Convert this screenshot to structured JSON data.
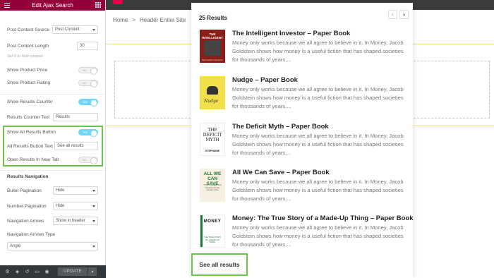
{
  "panel": {
    "title": "Edit Ajax Search",
    "post_content_source": {
      "label": "Post Content Source",
      "value": "Post Content"
    },
    "post_content_length": {
      "label": "Post Content Length",
      "value": "30"
    },
    "hint": "Set 0 to hide content",
    "show_product_price": {
      "label": "Show Product Price",
      "state": "NO"
    },
    "show_product_rating": {
      "label": "Show Product Rating",
      "state": "NO"
    },
    "show_results_counter": {
      "label": "Show Results Counter",
      "state": "YES"
    },
    "results_counter_text": {
      "label": "Results Counter Text",
      "value": "Results"
    },
    "show_all_results_button": {
      "label": "Show All Results Button",
      "state": "YES"
    },
    "all_results_button_text": {
      "label": "All Results Button Text",
      "value": "See all results"
    },
    "open_results_new_tab": {
      "label": "Open Results In New Tab",
      "state": "NO"
    },
    "results_navigation_title": "Results Navigation",
    "bullet_pagination": {
      "label": "Bullet Pagination",
      "value": "Hide"
    },
    "number_pagination": {
      "label": "Number Pagination",
      "value": "Hide"
    },
    "navigation_arrows": {
      "label": "Navigation Arrows",
      "value": "Show in header"
    },
    "navigation_arrows_type": {
      "label": "Navigation Arrows Type",
      "value": "Angle"
    },
    "footer": {
      "update_label": "UPDATE"
    }
  },
  "breadcrumb": {
    "home": "Home",
    "sep": ">",
    "current": "Header Entire Site"
  },
  "results": {
    "count_label": "25 Results",
    "see_all_label": "See all results",
    "items": [
      {
        "title": "The Intelligent Investor – Paper Book",
        "desc": "Money only works because we all agree to believe in it. In Money, Jacob Goldstein shows how money is a useful fiction that has shaped societies for thousands of years,...",
        "cover_title": "THE INTELLIGENT INVESTOR",
        "cover_author": "BENJAMIN GRAHAM"
      },
      {
        "title": "Nudge – Paper Book",
        "desc": "Money only works because we all agree to believe in it. In Money, Jacob Goldstein shows how money is a useful fiction that has shaped societies for thousands of years,...",
        "cover_title": "Nudge"
      },
      {
        "title": "The Deficit Myth – Paper Book",
        "desc": "Money only works because we all agree to believe in it. In Money, Jacob Goldstein shows how money is a useful fiction that has shaped societies for thousands of years,...",
        "cover_title": "THE DEFICIT MYTH",
        "cover_author": "STEPHANIE"
      },
      {
        "title": "All We Can Save – Paper Book",
        "desc": "Money only works because we all agree to believe in it. In Money, Jacob Goldstein shows how money is a useful fiction that has shaped societies for thousands of years,...",
        "cover_title": "ALL WE CAN SAVE",
        "cover_sub": "Truth, Courage, and Solutions for the Climate Crisis"
      },
      {
        "title": "Money: The True Story of a Made-Up Thing – Paper Book",
        "desc": "Money only works because we all agree to believe in it. In Money, Jacob Goldstein shows how money is a useful fiction that has shaped societies for thousands of years,...",
        "cover_title": "MONEY",
        "cover_sub": "THE TRUE STORY OF A MADE-UP THING"
      }
    ]
  },
  "colors": {
    "brand": "#93003c",
    "highlight": "#6cc24a",
    "toggle_on": "#71d7f7"
  },
  "icons": [
    "menu-icon",
    "apps-grid-icon",
    "settings-icon",
    "layers-icon",
    "history-icon",
    "responsive-icon",
    "preview-eye-icon",
    "chevron-left-icon",
    "chevron-right-icon"
  ]
}
